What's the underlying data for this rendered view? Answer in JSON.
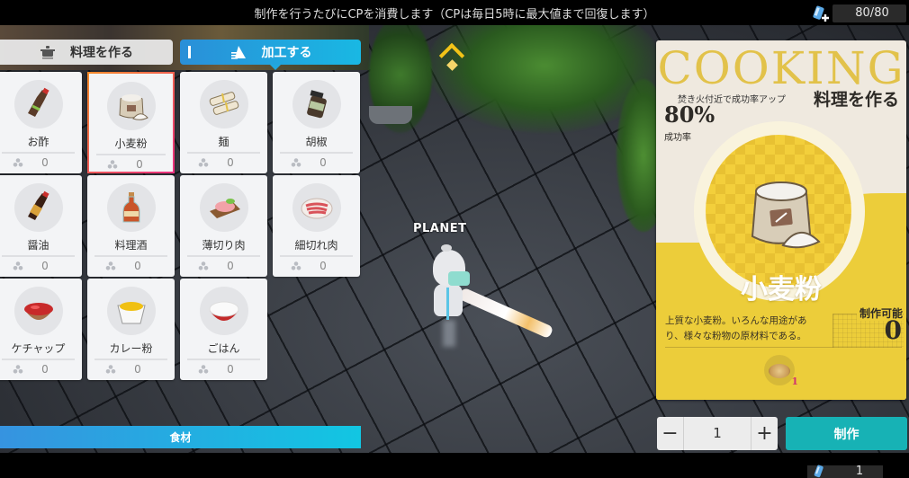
{
  "top_bar": {
    "notice": "制作を行うたびにCPを消費します（CPは毎日5時に最大値まで回復します）",
    "cp_icon": "cp-can-plus-icon",
    "cp_value": "80/80"
  },
  "tabs": [
    {
      "label": "料理を作る",
      "icon": "cooking-pot-icon",
      "active": false
    },
    {
      "label": "加工する",
      "icon": "processing-icon",
      "active": true
    }
  ],
  "items": [
    {
      "name": "お酢",
      "count": "0",
      "icon": "vinegar-bottle-icon",
      "selected": false
    },
    {
      "name": "小麦粉",
      "count": "0",
      "icon": "flour-sack-icon",
      "selected": true
    },
    {
      "name": "麺",
      "count": "0",
      "icon": "noodles-icon",
      "selected": false
    },
    {
      "name": "胡椒",
      "count": "0",
      "icon": "pepper-jar-icon",
      "selected": false
    },
    {
      "name": "醤油",
      "count": "0",
      "icon": "soy-sauce-bottle-icon",
      "selected": false
    },
    {
      "name": "料理酒",
      "count": "0",
      "icon": "cooking-sake-bottle-icon",
      "selected": false
    },
    {
      "name": "薄切り肉",
      "count": "0",
      "icon": "sliced-meat-icon",
      "selected": false
    },
    {
      "name": "細切れ肉",
      "count": "0",
      "icon": "chopped-meat-icon",
      "selected": false
    },
    {
      "name": "ケチャップ",
      "count": "0",
      "icon": "ketchup-bowl-icon",
      "selected": false
    },
    {
      "name": "カレー粉",
      "count": "0",
      "icon": "curry-powder-icon",
      "selected": false
    },
    {
      "name": "ごはん",
      "count": "0",
      "icon": "rice-bowl-icon",
      "selected": false
    }
  ],
  "materials_bar": {
    "label": "食材"
  },
  "game": {
    "player_name": "PLANET",
    "waypoint_icon": "waypoint-marker-icon"
  },
  "detail": {
    "title": "COOKING",
    "bonus_note": "焚き火付近で成功率アップ",
    "heading": "料理を作る",
    "success_rate": "80%",
    "success_label": "成功率",
    "item_name": "小麦粉",
    "description": "上質な小麦粉。いろんな用途があり、様々な粉物の原材料である。",
    "craftable_label": "制作可能",
    "craftable_value": "0",
    "ingredients": [
      {
        "icon": "wheat-ingredient-icon",
        "quantity": "1"
      }
    ]
  },
  "controls": {
    "quantity": "1",
    "minus_label": "−",
    "plus_label": "+",
    "craft_label": "制作"
  },
  "bottom_bar": {
    "icon": "cp-can-icon",
    "value": "1"
  },
  "colors": {
    "tab_active": "#1fa6e0",
    "craft_button": "#17b2b5",
    "panel_yellow": "#eccd3a",
    "cooking_title": "#e2c24a",
    "selected_border": "#ea2f7f"
  }
}
